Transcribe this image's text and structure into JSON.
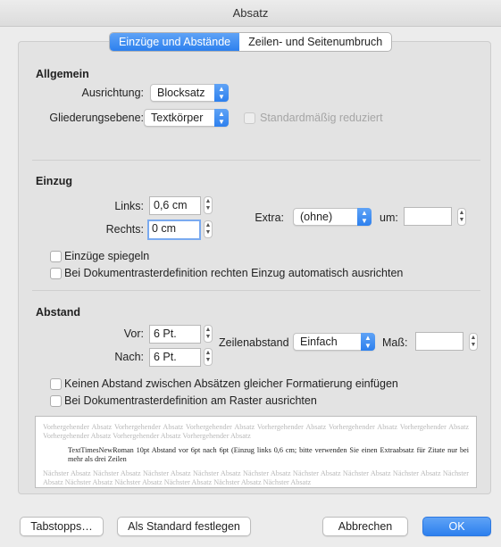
{
  "window": {
    "title": "Absatz"
  },
  "tabs": [
    {
      "label": "Einzüge und Abstände",
      "active": true
    },
    {
      "label": "Zeilen- und Seitenumbruch",
      "active": false
    }
  ],
  "general": {
    "heading": "Allgemein",
    "alignment_label": "Ausrichtung:",
    "alignment_value": "Blocksatz",
    "outline_label": "Gliederungsebene:",
    "outline_value": "Textkörper",
    "collapsed_label": "Standardmäßig reduziert"
  },
  "indent": {
    "heading": "Einzug",
    "left_label": "Links:",
    "left_value": "0,6 cm",
    "right_label": "Rechts:",
    "right_value": "0 cm",
    "extra_label": "Extra:",
    "extra_value": "(ohne)",
    "by_label": "um:",
    "by_value": "",
    "mirror_label": "Einzüge spiegeln",
    "grid_label": "Bei Dokumentrasterdefinition rechten Einzug automatisch ausrichten"
  },
  "spacing": {
    "heading": "Abstand",
    "before_label": "Vor:",
    "before_value": "6 Pt.",
    "after_label": "Nach:",
    "after_value": "6 Pt.",
    "line_label": "Zeilenabstand",
    "line_value": "Einfach",
    "measure_label": "Maß:",
    "measure_value": "",
    "no_space_label": "Keinen Abstand zwischen Absätzen gleicher Formatierung einfügen",
    "snap_grid_label": "Bei Dokumentrasterdefinition am Raster ausrichten"
  },
  "preview": {
    "previous": "Vorhergehender Absatz Vorhergehender Absatz Vorhergehender Absatz Vorhergehender Absatz Vorhergehender Absatz Vorhergehender Absatz Vorhergehender Absatz Vorhergehender Absatz Vorhergehender Absatz",
    "current": "TextTimesNewRoman 10pt Abstand vor 6pt nach 6pt (Einzug links 0,6 cm; bitte verwenden Sie einen Extraabsatz für Zitate nur bei mehr als drei Zeilen",
    "next": "Nächster Absatz Nächster Absatz Nächster Absatz Nächster Absatz Nächster Absatz Nächster Absatz Nächster Absatz Nächster Absatz Nächster Absatz Nächster Absatz Nächster Absatz Nächster Absatz Nächster Absatz Nächster Absatz"
  },
  "buttons": {
    "tabs": "Tabstopps…",
    "default": "Als Standard festlegen",
    "cancel": "Abbrechen",
    "ok": "OK"
  },
  "colors": {
    "accent": "#2d80ee"
  }
}
